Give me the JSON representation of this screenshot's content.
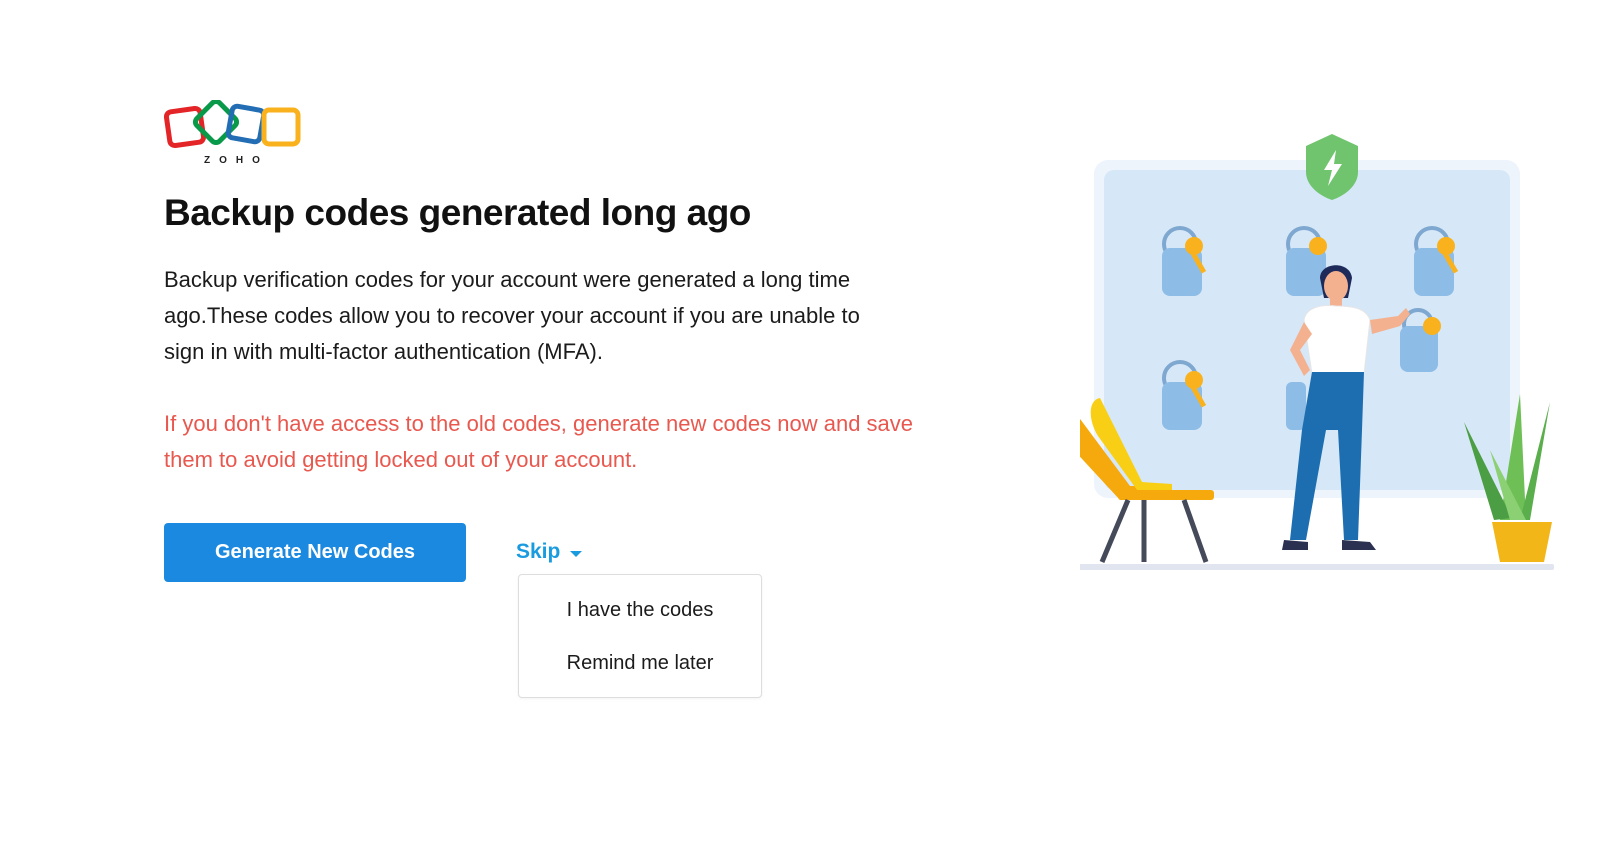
{
  "brand": {
    "logo_text": "ZOHO",
    "colors": {
      "red": "#e42527",
      "green": "#089949",
      "blue": "#226db4",
      "yellow": "#f9b21d"
    }
  },
  "main": {
    "title": "Backup codes generated long ago",
    "description": "Backup verification codes for your account were generated a long time ago.These codes allow you to recover your account if you are unable to sign in with multi-factor authentication (MFA).",
    "warning": "If you don't have access to the old codes, generate new codes now and save them to avoid getting locked out of your account.",
    "warning_color": "#e8584f"
  },
  "actions": {
    "generate_label": "Generate New Codes",
    "generate_color": "#1b89e0",
    "skip_label": "Skip",
    "skip_color": "#1a9be0",
    "skip_menu": [
      "I have the codes",
      "Remind me later"
    ]
  },
  "illustration": {
    "icons": [
      "shield-icon",
      "key-tag-icon",
      "chair-icon",
      "plant-icon",
      "person-illustration"
    ]
  }
}
